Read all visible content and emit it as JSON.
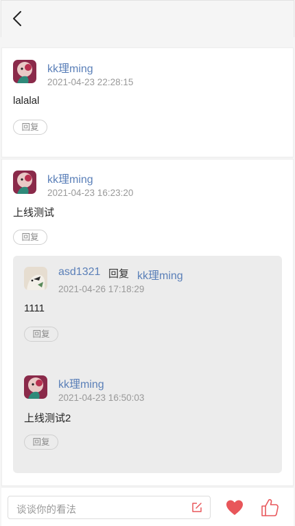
{
  "header": {
    "back_icon": "chevron-left-icon"
  },
  "comments": [
    {
      "username": "kk理ming",
      "time": "2021-04-23 22:28:15",
      "content": "lalalal",
      "reply_label": "回复"
    },
    {
      "username": "kk理ming",
      "time": "2021-04-23 16:23:20",
      "content": "上线测试",
      "reply_label": "回复",
      "replies": [
        {
          "username": "asd1321",
          "reply_word": "回复",
          "reply_to": "kk理ming",
          "time": "2021-04-26 17:18:29",
          "content": "1111",
          "reply_label": "回复"
        },
        {
          "username": "kk理ming",
          "time": "2021-04-23 16:50:03",
          "content": "上线测试2",
          "reply_label": "回复"
        }
      ]
    }
  ],
  "bottom_bar": {
    "input_placeholder": "谈谈你的看法",
    "edit_icon": "edit-icon",
    "heart_icon": "heart-icon",
    "like_icon": "thumbs-up-icon"
  },
  "colors": {
    "username": "#5a7fb8",
    "timestamp": "#999999",
    "accent_red": "#e8565a",
    "nested_bg": "#ececec"
  }
}
